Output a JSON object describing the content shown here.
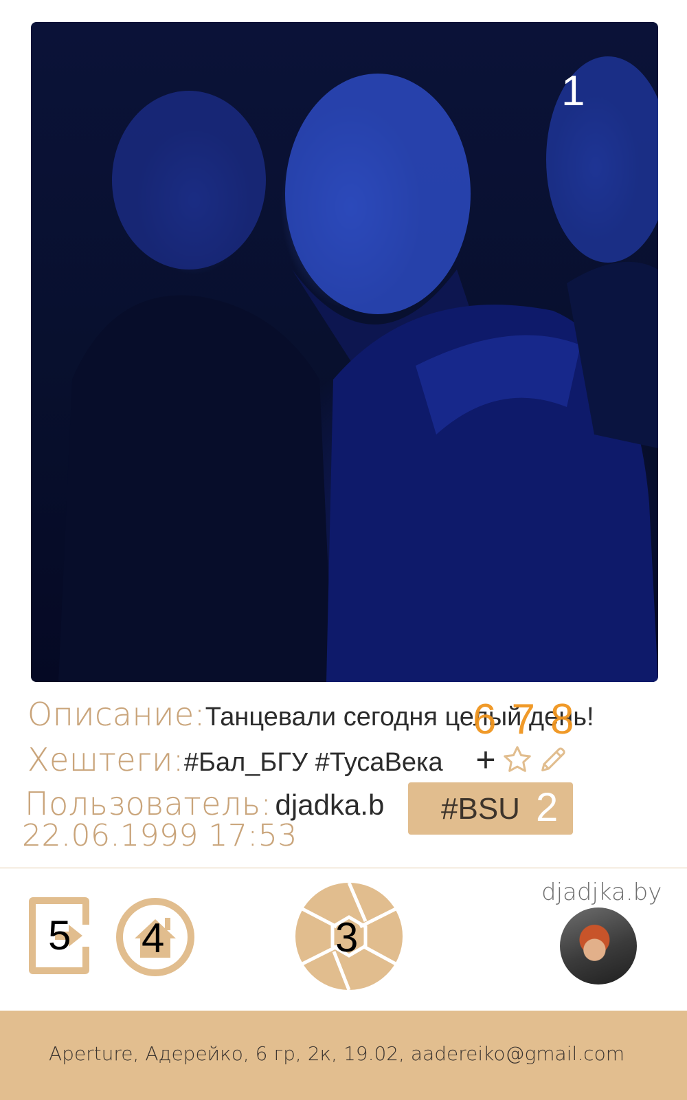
{
  "photo": {
    "marker": "1"
  },
  "info": {
    "description_label": "Описание:",
    "description_value": "Танцевали сегодня целый день!",
    "hashtags_label": "Хештеги:",
    "hashtags_value": "#Бал_БГУ #ТусаВека",
    "user_label": "Пользователь:",
    "user_value": "djadka.b",
    "date": "22.06.1999 17:53",
    "overlay_markers": "678",
    "hashtag_actions": {
      "add_icon": "plus-icon",
      "favorite_icon": "star-icon",
      "edit_icon": "pencil-icon",
      "add_glyph": "+"
    },
    "chip": {
      "text": "#BSU",
      "marker": "2"
    }
  },
  "toolbar": {
    "exit_marker": "5",
    "exit_icon": "exit-icon",
    "home_marker": "4",
    "home_icon": "home-icon",
    "camera_marker": "3",
    "camera_icon": "aperture-icon",
    "brand": "djadjka.by",
    "avatar_icon": "avatar"
  },
  "footer": {
    "text": "Aperture, Адерейко, 6 гр, 2к, 19.02, aadereiko@gmail.com"
  },
  "colors": {
    "accent": "#e1bd8e",
    "label": "#c9a47a",
    "marker_orange": "#f0951e"
  }
}
